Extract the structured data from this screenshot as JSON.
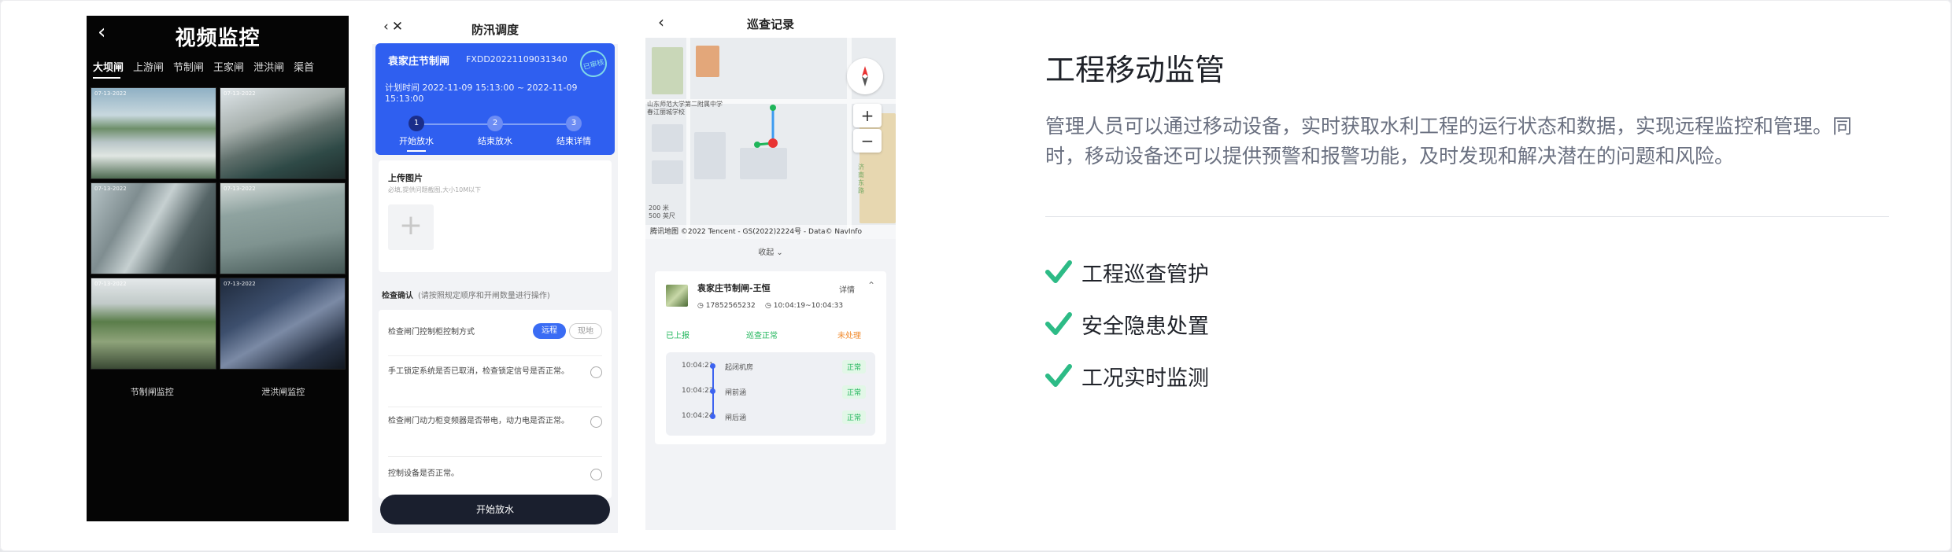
{
  "phone1": {
    "title": "视频监控",
    "tabs": [
      "大坝闸",
      "上游闸",
      "节制闸",
      "王家闸",
      "泄洪闸",
      "渠首"
    ],
    "active_tab": 0,
    "camera_timestamps": [
      "07-13-2022",
      "07-13-2022",
      "07-13-2022",
      "07-13-2022",
      "07-13-2022",
      "07-13-2022"
    ],
    "bottom_labels": [
      "节制闸监控",
      "泄洪闸监控"
    ]
  },
  "phone2": {
    "title": "防汛调度",
    "gate_name": "袁家庄节制闸",
    "code": "FXDD20221109031340",
    "stamp": "已审核",
    "plan_time": "计划时间 2022-11-09 15:13:00 ~ 2022-11-09 15:13:00",
    "steps": [
      {
        "num": "1",
        "label": "开始放水"
      },
      {
        "num": "2",
        "label": "结束放水"
      },
      {
        "num": "3",
        "label": "结束详情"
      }
    ],
    "upload_title": "上传图片",
    "upload_hint": "必填,提供问题截图,大小10M以下",
    "upload_plus": "+",
    "check_title": "检查确认",
    "check_hint": "(请按照规定顺序和开闸数量进行操作)",
    "control_label": "检查闸门控制柜控制方式",
    "control_opt_remote": "远程",
    "control_opt_local": "现地",
    "check_items": [
      "手工锁定系统是否已取消，检查锁定信号是否正常。",
      "检查闸门动力柜变频器是否带电，动力电是否正常。",
      "控制设备是否正常。"
    ],
    "button": "开始放水"
  },
  "phone3": {
    "title": "巡查记录",
    "map_label_school": "山东师范大学第二附属中学春江丽城学校",
    "map_label_road": "济南东路",
    "scale_1": "200 米",
    "scale_2": "500 英尺",
    "attribution": "腾讯地图 ©2022 Tencent - GS(2022)2224号 - Data© NavInfo",
    "zoom_in": "+",
    "zoom_out": "−",
    "fold": "收起",
    "record_name": "袁家庄节制闸-王恒",
    "detail": "详情",
    "phone": "17852565232",
    "time_range": "10:04:19~10:04:33",
    "statuses": [
      {
        "label": "已上报",
        "color": "#1fb55a"
      },
      {
        "label": "巡查正常",
        "color": "#1fb55a"
      },
      {
        "label": "未处理",
        "color": "#f08a2c"
      }
    ],
    "timeline": [
      {
        "time": "10:04:21",
        "item": "起闭机房",
        "status": "正常"
      },
      {
        "time": "10:04:23",
        "item": "闸前涵",
        "status": "正常"
      },
      {
        "time": "10:04:24",
        "item": "闸后涵",
        "status": "正常"
      }
    ]
  },
  "content": {
    "title": "工程移动监管",
    "description": "管理人员可以通过移动设备，实时获取水利工程的运行状态和数据，实现远程监控和管理。同时，移动设备还可以提供预警和报警功能，及时发现和解决潜在的问题和风险。",
    "features": [
      "工程巡查管护",
      "安全隐患处置",
      "工况实时监测"
    ],
    "check_color": "#2dbb86"
  }
}
